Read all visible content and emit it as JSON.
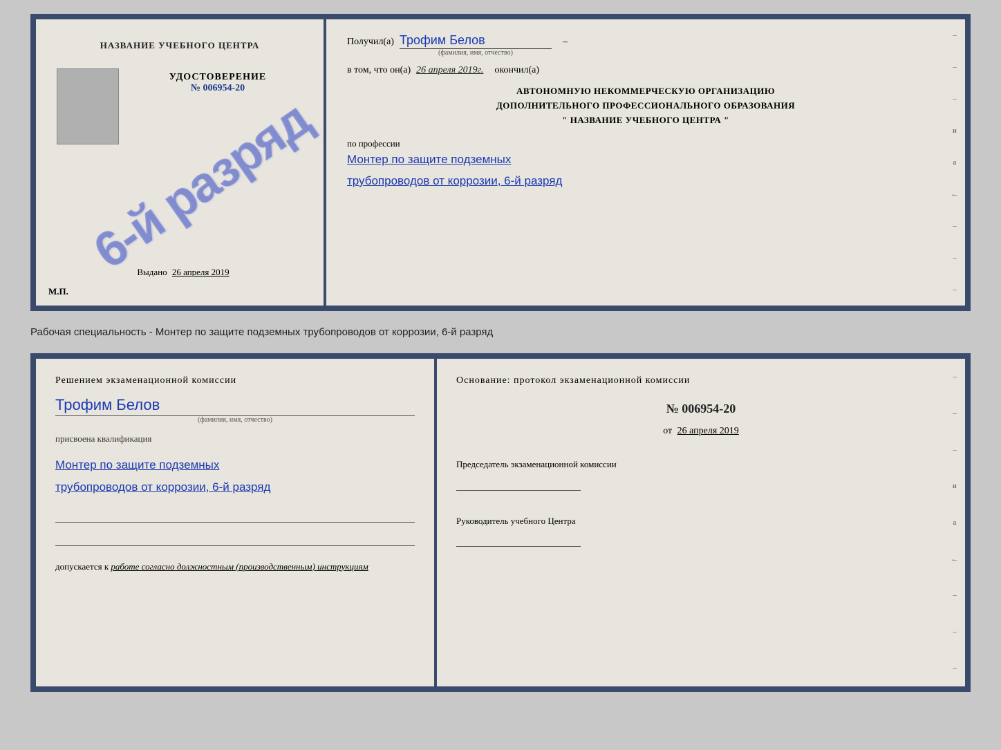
{
  "diploma": {
    "left": {
      "center_title": "НАЗВАНИЕ УЧЕБНОГО ЦЕНТРА",
      "stamp_text": "6-й разряд",
      "udostoverenie_label": "УДОСТОВЕРЕНИЕ",
      "nomer": "№ 006954-20",
      "vydano_label": "Выдано",
      "vydano_date": "26 апреля 2019",
      "mp_label": "М.П."
    },
    "right": {
      "poluchil_label": "Получил(а)",
      "poluchil_name": "Трофим Белов",
      "fio_hint": "(фамилия, имя, отчество)",
      "dash": "–",
      "vtom_label": "в том, что он(а)",
      "vtom_date": "26 апреля 2019г.",
      "okonchil_label": "окончил(а)",
      "org_line1": "АВТОНОМНУЮ НЕКОММЕРЧЕСКУЮ ОРГАНИЗАЦИЮ",
      "org_line2": "ДОПОЛНИТЕЛЬНОГО ПРОФЕССИОНАЛЬНОГО ОБРАЗОВАНИЯ",
      "org_line3": "\" НАЗВАНИЕ УЧЕБНОГО ЦЕНТРА \"",
      "po_professii": "по профессии",
      "professiya": "Монтер по защите подземных трубопроводов от коррозии, 6-й разряд",
      "right_chars": [
        "–",
        "–",
        "–",
        "и",
        "а",
        "←",
        "–",
        "–",
        "–"
      ]
    }
  },
  "specialnost": {
    "text": "Рабочая специальность - Монтер по защите подземных трубопроводов от коррозии, 6-й разряд"
  },
  "bottom": {
    "left": {
      "resheniem": "Решением экзаменационной комиссии",
      "fio": "Трофим Белов",
      "fio_hint": "(фамилия, имя, отчество)",
      "prisvoena": "присвоена квалификация",
      "kvalifikatsiya": "Монтер по защите подземных трубопроводов от коррозии, 6-й разряд",
      "dopuskaetsya_label": "допускается к",
      "dopuskaetsya_value": "работе согласно должностным (производственным) инструкциям"
    },
    "right": {
      "osnovanie": "Основание: протокол экзаменационной комиссии",
      "nomer": "№ 006954-20",
      "ot_label": "от",
      "ot_date": "26 апреля 2019",
      "predsedatel_label": "Председатель экзаменационной комиссии",
      "rukovoditel_label": "Руководитель учебного Центра",
      "right_chars": [
        "–",
        "–",
        "–",
        "и",
        "а",
        "←",
        "–",
        "–",
        "–"
      ]
    }
  }
}
